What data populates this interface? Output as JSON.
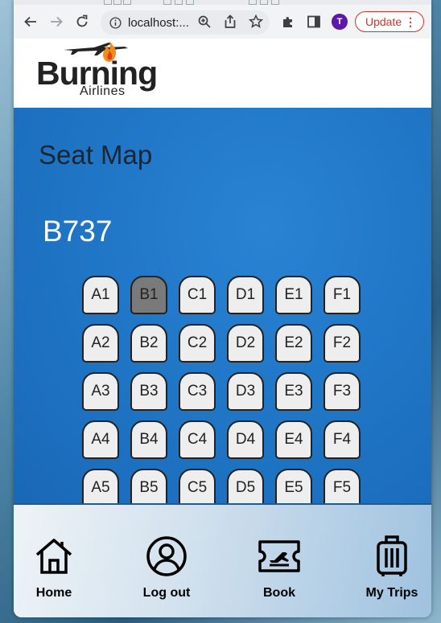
{
  "browser": {
    "url": "localhost:...",
    "profile_initial": "T",
    "update_label": "Update",
    "update_menu_glyph": "⋮",
    "colors": {
      "profile": "#5e17a8",
      "update": "#d93025"
    },
    "icons": [
      "back-arrow-icon",
      "forward-arrow-icon",
      "reload-icon",
      "info-icon",
      "zoom-icon",
      "share-icon",
      "bookmark-star-icon",
      "extensions-puzzle-icon",
      "side-panel-icon",
      "kebab-menu-icon"
    ]
  },
  "site": {
    "logo_word": "Burning",
    "logo_sub": "Airlines",
    "logo_icons": [
      "airplane-icon",
      "flame-icon"
    ]
  },
  "seatmap": {
    "title": "Seat Map",
    "aircraft": "B737",
    "rows": [
      [
        "A1",
        "B1",
        "C1",
        "D1",
        "E1",
        "F1"
      ],
      [
        "A2",
        "B2",
        "C2",
        "D2",
        "E2",
        "F2"
      ],
      [
        "A3",
        "B3",
        "C3",
        "D3",
        "E3",
        "F3"
      ],
      [
        "A4",
        "B4",
        "C4",
        "D4",
        "E4",
        "F4"
      ],
      [
        "A5",
        "B5",
        "C5",
        "D5",
        "E5",
        "F5"
      ]
    ],
    "selected": [
      "B1"
    ],
    "colors": {
      "background": "#1f74c4",
      "seat": "#eeeeee",
      "seat_selected": "#7a7a7a"
    }
  },
  "nav": {
    "items": [
      {
        "label": "Home",
        "icon": "home-icon"
      },
      {
        "label": "Log out",
        "icon": "user-circle-icon"
      },
      {
        "label": "Book",
        "icon": "boarding-pass-icon"
      },
      {
        "label": "My Trips",
        "icon": "luggage-icon"
      }
    ]
  }
}
